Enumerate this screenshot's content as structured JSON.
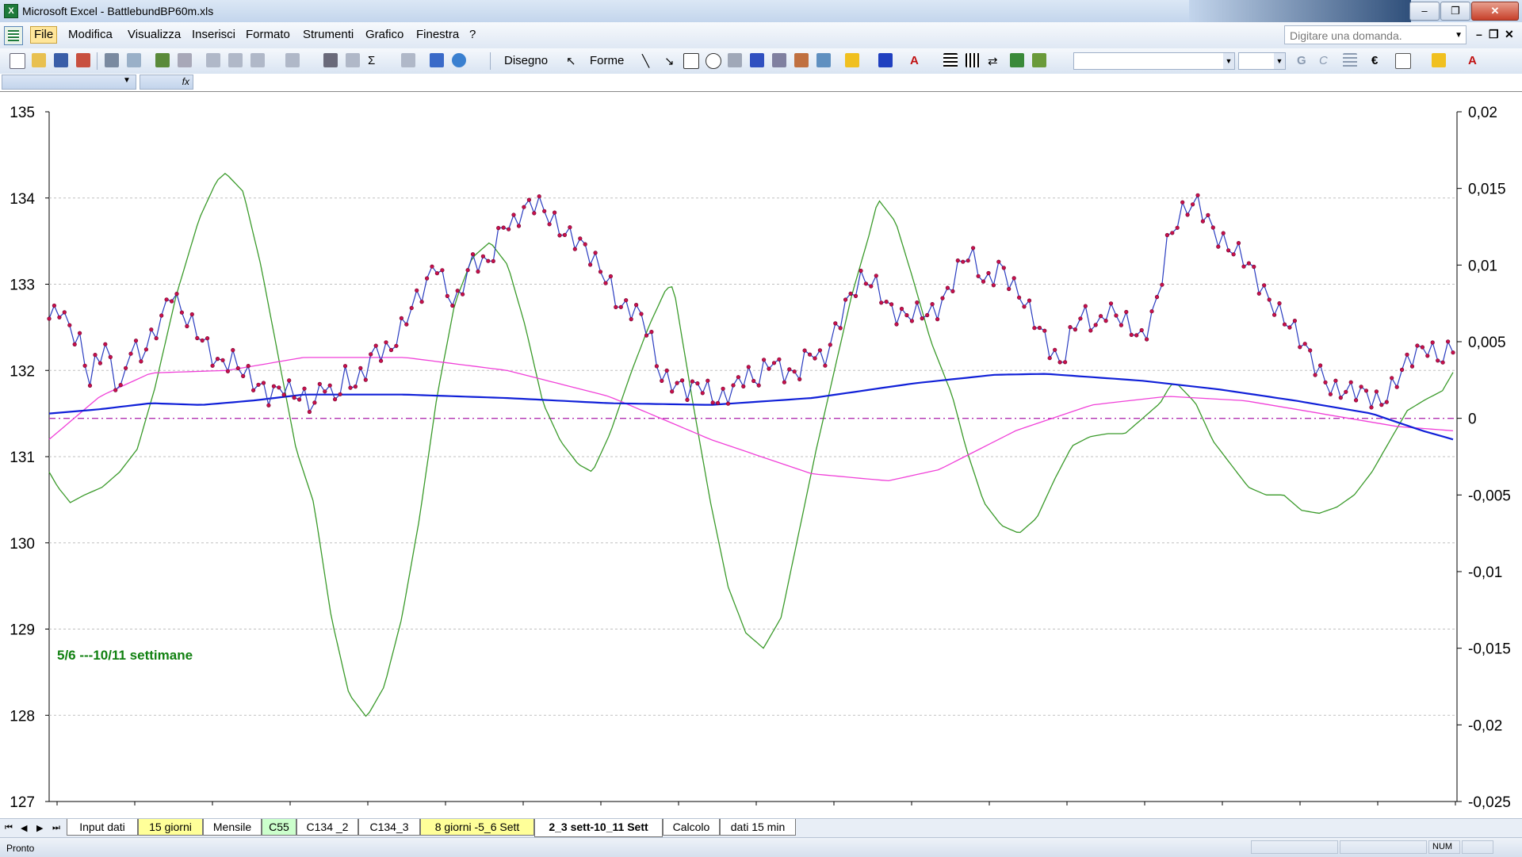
{
  "window": {
    "title": "Microsoft Excel - BattlebundBP60m.xls",
    "app_icon": "excel-icon",
    "buttons": [
      "minimize",
      "restore",
      "close"
    ]
  },
  "menu": {
    "items": [
      "File",
      "Modifica",
      "Visualizza",
      "Inserisci",
      "Formato",
      "Strumenti",
      "Grafico",
      "Finestra",
      "?"
    ],
    "active": "File",
    "help_placeholder": "Digitare una domanda."
  },
  "toolbar": {
    "drawing_label": "Disegno",
    "shapes_label": "Forme"
  },
  "chart_data": {
    "type": "line",
    "y_left": {
      "min": 127,
      "max": 135,
      "ticks": [
        "135",
        "134",
        "133",
        "132",
        "131",
        "130",
        "129",
        "128",
        "127"
      ]
    },
    "y_right": {
      "min": -0.025,
      "max": 0.02,
      "ticks": [
        "0,02",
        "0,015",
        "0,01",
        "0,005",
        "0",
        "-0,005",
        "-0,01",
        "-0,015",
        "-0,02",
        "-0,025"
      ]
    },
    "grid": "horizontal dashed",
    "annotation": "5/6 ---10/11 settimane",
    "x_count": 276,
    "colors": {
      "price": "#2a3cc0",
      "marker": "#c8104a",
      "blue_ma": "#1020d8",
      "pink": "#f040d8",
      "green": "#3a9a2a",
      "zero": "#b030b0",
      "annotation": "#108010"
    },
    "series": [
      {
        "axis": "left",
        "keys": [
          [
            0,
            132.6
          ],
          [
            2,
            132.8
          ],
          [
            6,
            132.3
          ],
          [
            8,
            131.8
          ],
          [
            9,
            132
          ],
          [
            11,
            132.3
          ],
          [
            14,
            131.8
          ],
          [
            16,
            132.3
          ],
          [
            18,
            132.1
          ],
          [
            20,
            132.3
          ],
          [
            22,
            132.6
          ],
          [
            24,
            133
          ],
          [
            27,
            132.6
          ],
          [
            30,
            132.3
          ],
          [
            33,
            132.1
          ],
          [
            36,
            132.2
          ],
          [
            40,
            131.8
          ],
          [
            43,
            131.7
          ],
          [
            46,
            131.9
          ],
          [
            49,
            131.7
          ],
          [
            52,
            131.5
          ],
          [
            54,
            131.9
          ],
          [
            56,
            131.7
          ],
          [
            58,
            132
          ],
          [
            60,
            131.8
          ],
          [
            62,
            131.9
          ],
          [
            64,
            132.2
          ],
          [
            67,
            132.3
          ],
          [
            70,
            132.6
          ],
          [
            74,
            132.9
          ],
          [
            76,
            133.3
          ],
          [
            78,
            133
          ],
          [
            80,
            132.8
          ],
          [
            83,
            133.2
          ],
          [
            86,
            133.2
          ],
          [
            88,
            133.5
          ],
          [
            89,
            133.8
          ],
          [
            91,
            133.7
          ],
          [
            93,
            133.8
          ],
          [
            96,
            133.9
          ],
          [
            99,
            133.8
          ],
          [
            102,
            133.6
          ],
          [
            106,
            133.3
          ],
          [
            110,
            133.1
          ],
          [
            112,
            132.8
          ],
          [
            116,
            132.6
          ],
          [
            118,
            132.4
          ],
          [
            120,
            132
          ],
          [
            123,
            131.9
          ],
          [
            126,
            131.7
          ],
          [
            128,
            131.8
          ],
          [
            131,
            131.7
          ],
          [
            134,
            131.8
          ],
          [
            137,
            131.9
          ],
          [
            139,
            131.8
          ],
          [
            142,
            132.2
          ],
          [
            145,
            132
          ],
          [
            147,
            131.9
          ],
          [
            150,
            132.2
          ],
          [
            152,
            132.1
          ],
          [
            155,
            132.6
          ],
          [
            157,
            132.8
          ],
          [
            160,
            133.0
          ],
          [
            163,
            133.0
          ],
          [
            165,
            132.8
          ],
          [
            168,
            132.6
          ],
          [
            171,
            132.6
          ],
          [
            174,
            132.7
          ],
          [
            177,
            133.0
          ],
          [
            179,
            133.2
          ],
          [
            181,
            133.3
          ],
          [
            184,
            133.0
          ],
          [
            187,
            133.3
          ],
          [
            190,
            132.9
          ],
          [
            193,
            132.6
          ],
          [
            196,
            132.4
          ],
          [
            199,
            132.1
          ],
          [
            201,
            132.4
          ],
          [
            203,
            132.6
          ],
          [
            206,
            132.5
          ],
          [
            208,
            132.8
          ],
          [
            211,
            132.6
          ],
          [
            213,
            132.4
          ],
          [
            215,
            132.3
          ],
          [
            218,
            132.9
          ],
          [
            220,
            133.6
          ],
          [
            223,
            133.8
          ],
          [
            226,
            133.9
          ],
          [
            230,
            133.6
          ],
          [
            234,
            133.3
          ],
          [
            238,
            133.0
          ],
          [
            241,
            132.8
          ],
          [
            244,
            132.5
          ],
          [
            247,
            132.2
          ],
          [
            250,
            132
          ],
          [
            253,
            131.8
          ],
          [
            256,
            131.7
          ],
          [
            259,
            131.7
          ],
          [
            262,
            131.7
          ],
          [
            265,
            131.9
          ],
          [
            268,
            132.1
          ],
          [
            271,
            132.3
          ],
          [
            274,
            132.2
          ],
          [
            276,
            132.3
          ]
        ]
      },
      {
        "axis": "left",
        "keys": [
          [
            0,
            131.5
          ],
          [
            10,
            131.55
          ],
          [
            20,
            131.62
          ],
          [
            30,
            131.6
          ],
          [
            40,
            131.65
          ],
          [
            50,
            131.72
          ],
          [
            70,
            131.72
          ],
          [
            90,
            131.68
          ],
          [
            110,
            131.62
          ],
          [
            130,
            131.6
          ],
          [
            150,
            131.68
          ],
          [
            170,
            131.85
          ],
          [
            186,
            131.95
          ],
          [
            196,
            131.96
          ],
          [
            215,
            131.88
          ],
          [
            230,
            131.78
          ],
          [
            245,
            131.65
          ],
          [
            260,
            131.5
          ],
          [
            270,
            131.3
          ],
          [
            276,
            131.2
          ]
        ]
      },
      {
        "axis": "left",
        "keys": [
          [
            0,
            131.2
          ],
          [
            10,
            131.7
          ],
          [
            20,
            131.97
          ],
          [
            35,
            132
          ],
          [
            50,
            132.15
          ],
          [
            70,
            132.15
          ],
          [
            90,
            132
          ],
          [
            110,
            131.7
          ],
          [
            130,
            131.2
          ],
          [
            150,
            130.8
          ],
          [
            165,
            130.72
          ],
          [
            175,
            130.85
          ],
          [
            190,
            131.3
          ],
          [
            205,
            131.6
          ],
          [
            220,
            131.7
          ],
          [
            235,
            131.65
          ],
          [
            250,
            131.5
          ],
          [
            265,
            131.35
          ],
          [
            276,
            131.3
          ]
        ]
      },
      {
        "axis": "right",
        "keys": [
          [
            0,
            -0.0035
          ],
          [
            5,
            -0.0045
          ],
          [
            12,
            -0.0055
          ],
          [
            20,
            -0.005
          ],
          [
            30,
            -0.0045
          ],
          [
            40,
            -0.0035
          ],
          [
            50,
            -0.002
          ],
          [
            60,
            0.002
          ],
          [
            72,
            0.008
          ],
          [
            85,
            0.013
          ],
          [
            95,
            0.0155
          ],
          [
            100,
            0.016
          ],
          [
            110,
            0.0148
          ],
          [
            120,
            0.01
          ],
          [
            130,
            0.004
          ],
          [
            140,
            -0.002
          ],
          [
            150,
            -0.0055
          ],
          [
            160,
            -0.013
          ],
          [
            170,
            -0.018
          ],
          [
            180,
            -0.0195
          ],
          [
            190,
            -0.0175
          ],
          [
            200,
            -0.013
          ],
          [
            210,
            -0.0065
          ],
          [
            220,
            0.0015
          ],
          [
            230,
            0.0075
          ],
          [
            240,
            0.0105
          ],
          [
            250,
            0.0115
          ],
          [
            260,
            0.01
          ],
          [
            270,
            0.006
          ],
          [
            280,
            0.001
          ],
          [
            290,
            -0.0015
          ],
          [
            300,
            -0.003
          ],
          [
            308,
            -0.0035
          ],
          [
            318,
            -0.001
          ],
          [
            330,
            0.003
          ],
          [
            340,
            0.006
          ],
          [
            350,
            0.0085
          ],
          [
            354,
            0.0086
          ],
          [
            365,
            0.001
          ],
          [
            375,
            -0.0055
          ],
          [
            385,
            -0.011
          ],
          [
            395,
            -0.014
          ],
          [
            405,
            -0.015
          ],
          [
            415,
            -0.013
          ],
          [
            425,
            -0.0075
          ],
          [
            435,
            -0.002
          ],
          [
            445,
            0.003
          ],
          [
            455,
            0.008
          ],
          [
            465,
            0.012
          ],
          [
            470,
            0.0143
          ],
          [
            480,
            0.0128
          ],
          [
            490,
            0.009
          ],
          [
            500,
            0.005
          ],
          [
            512,
            0.0015
          ],
          [
            520,
            -0.002
          ],
          [
            530,
            -0.0055
          ],
          [
            540,
            -0.007
          ],
          [
            550,
            -0.0075
          ],
          [
            560,
            -0.0065
          ],
          [
            570,
            -0.004
          ],
          [
            580,
            -0.0018
          ],
          [
            590,
            -0.0012
          ],
          [
            600,
            -0.001
          ],
          [
            610,
            -0.001
          ],
          [
            620,
            0
          ],
          [
            630,
            0.001
          ],
          [
            636,
            0.0022
          ],
          [
            640,
            0.0022
          ],
          [
            650,
            0.001
          ],
          [
            660,
            -0.0015
          ],
          [
            670,
            -0.003
          ],
          [
            680,
            -0.0045
          ],
          [
            690,
            -0.005
          ],
          [
            700,
            -0.005
          ],
          [
            710,
            -0.006
          ],
          [
            720,
            -0.0062
          ],
          [
            730,
            -0.0058
          ],
          [
            740,
            -0.005
          ],
          [
            750,
            -0.0035
          ],
          [
            760,
            -0.0015
          ],
          [
            770,
            0.0005
          ],
          [
            780,
            0.0012
          ],
          [
            790,
            0.0018
          ],
          [
            796,
            0.003
          ]
        ]
      }
    ]
  },
  "sheet_tabs": {
    "items": [
      {
        "label": "Input dati",
        "color": "white"
      },
      {
        "label": "15 giorni",
        "color": "yellow"
      },
      {
        "label": "Mensile",
        "color": "white"
      },
      {
        "label": "C55",
        "color": "green"
      },
      {
        "label": "C134 _2",
        "color": "white"
      },
      {
        "label": "C134_3",
        "color": "white"
      },
      {
        "label": "8 giorni -5_6 Sett",
        "color": "yellow"
      },
      {
        "label": "2_3 sett-10_11 Sett",
        "color": "active"
      },
      {
        "label": "Calcolo",
        "color": "white"
      },
      {
        "label": "dati 15 min",
        "color": "white"
      }
    ]
  },
  "status": {
    "ready": "Pronto",
    "num": "NUM"
  }
}
